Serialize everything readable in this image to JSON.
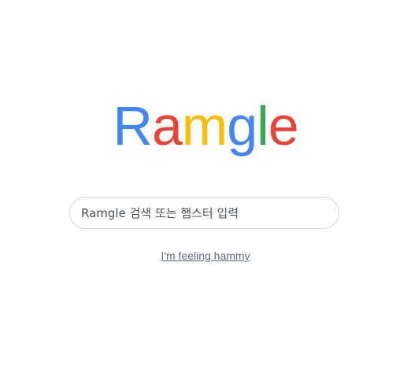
{
  "logo": {
    "letters": [
      {
        "char": "R",
        "color": "#4285f4"
      },
      {
        "char": "a",
        "color": "#ea4335"
      },
      {
        "char": "m",
        "color": "#fbbc05"
      },
      {
        "char": "g",
        "color": "#4285f4"
      },
      {
        "char": "l",
        "color": "#34a853"
      },
      {
        "char": "e",
        "color": "#ea4335"
      }
    ]
  },
  "search": {
    "placeholder": "Ramgle 검색 또는 햄스터 입력",
    "value": ""
  },
  "links": {
    "lucky_label": "I'm feeling hammy"
  }
}
